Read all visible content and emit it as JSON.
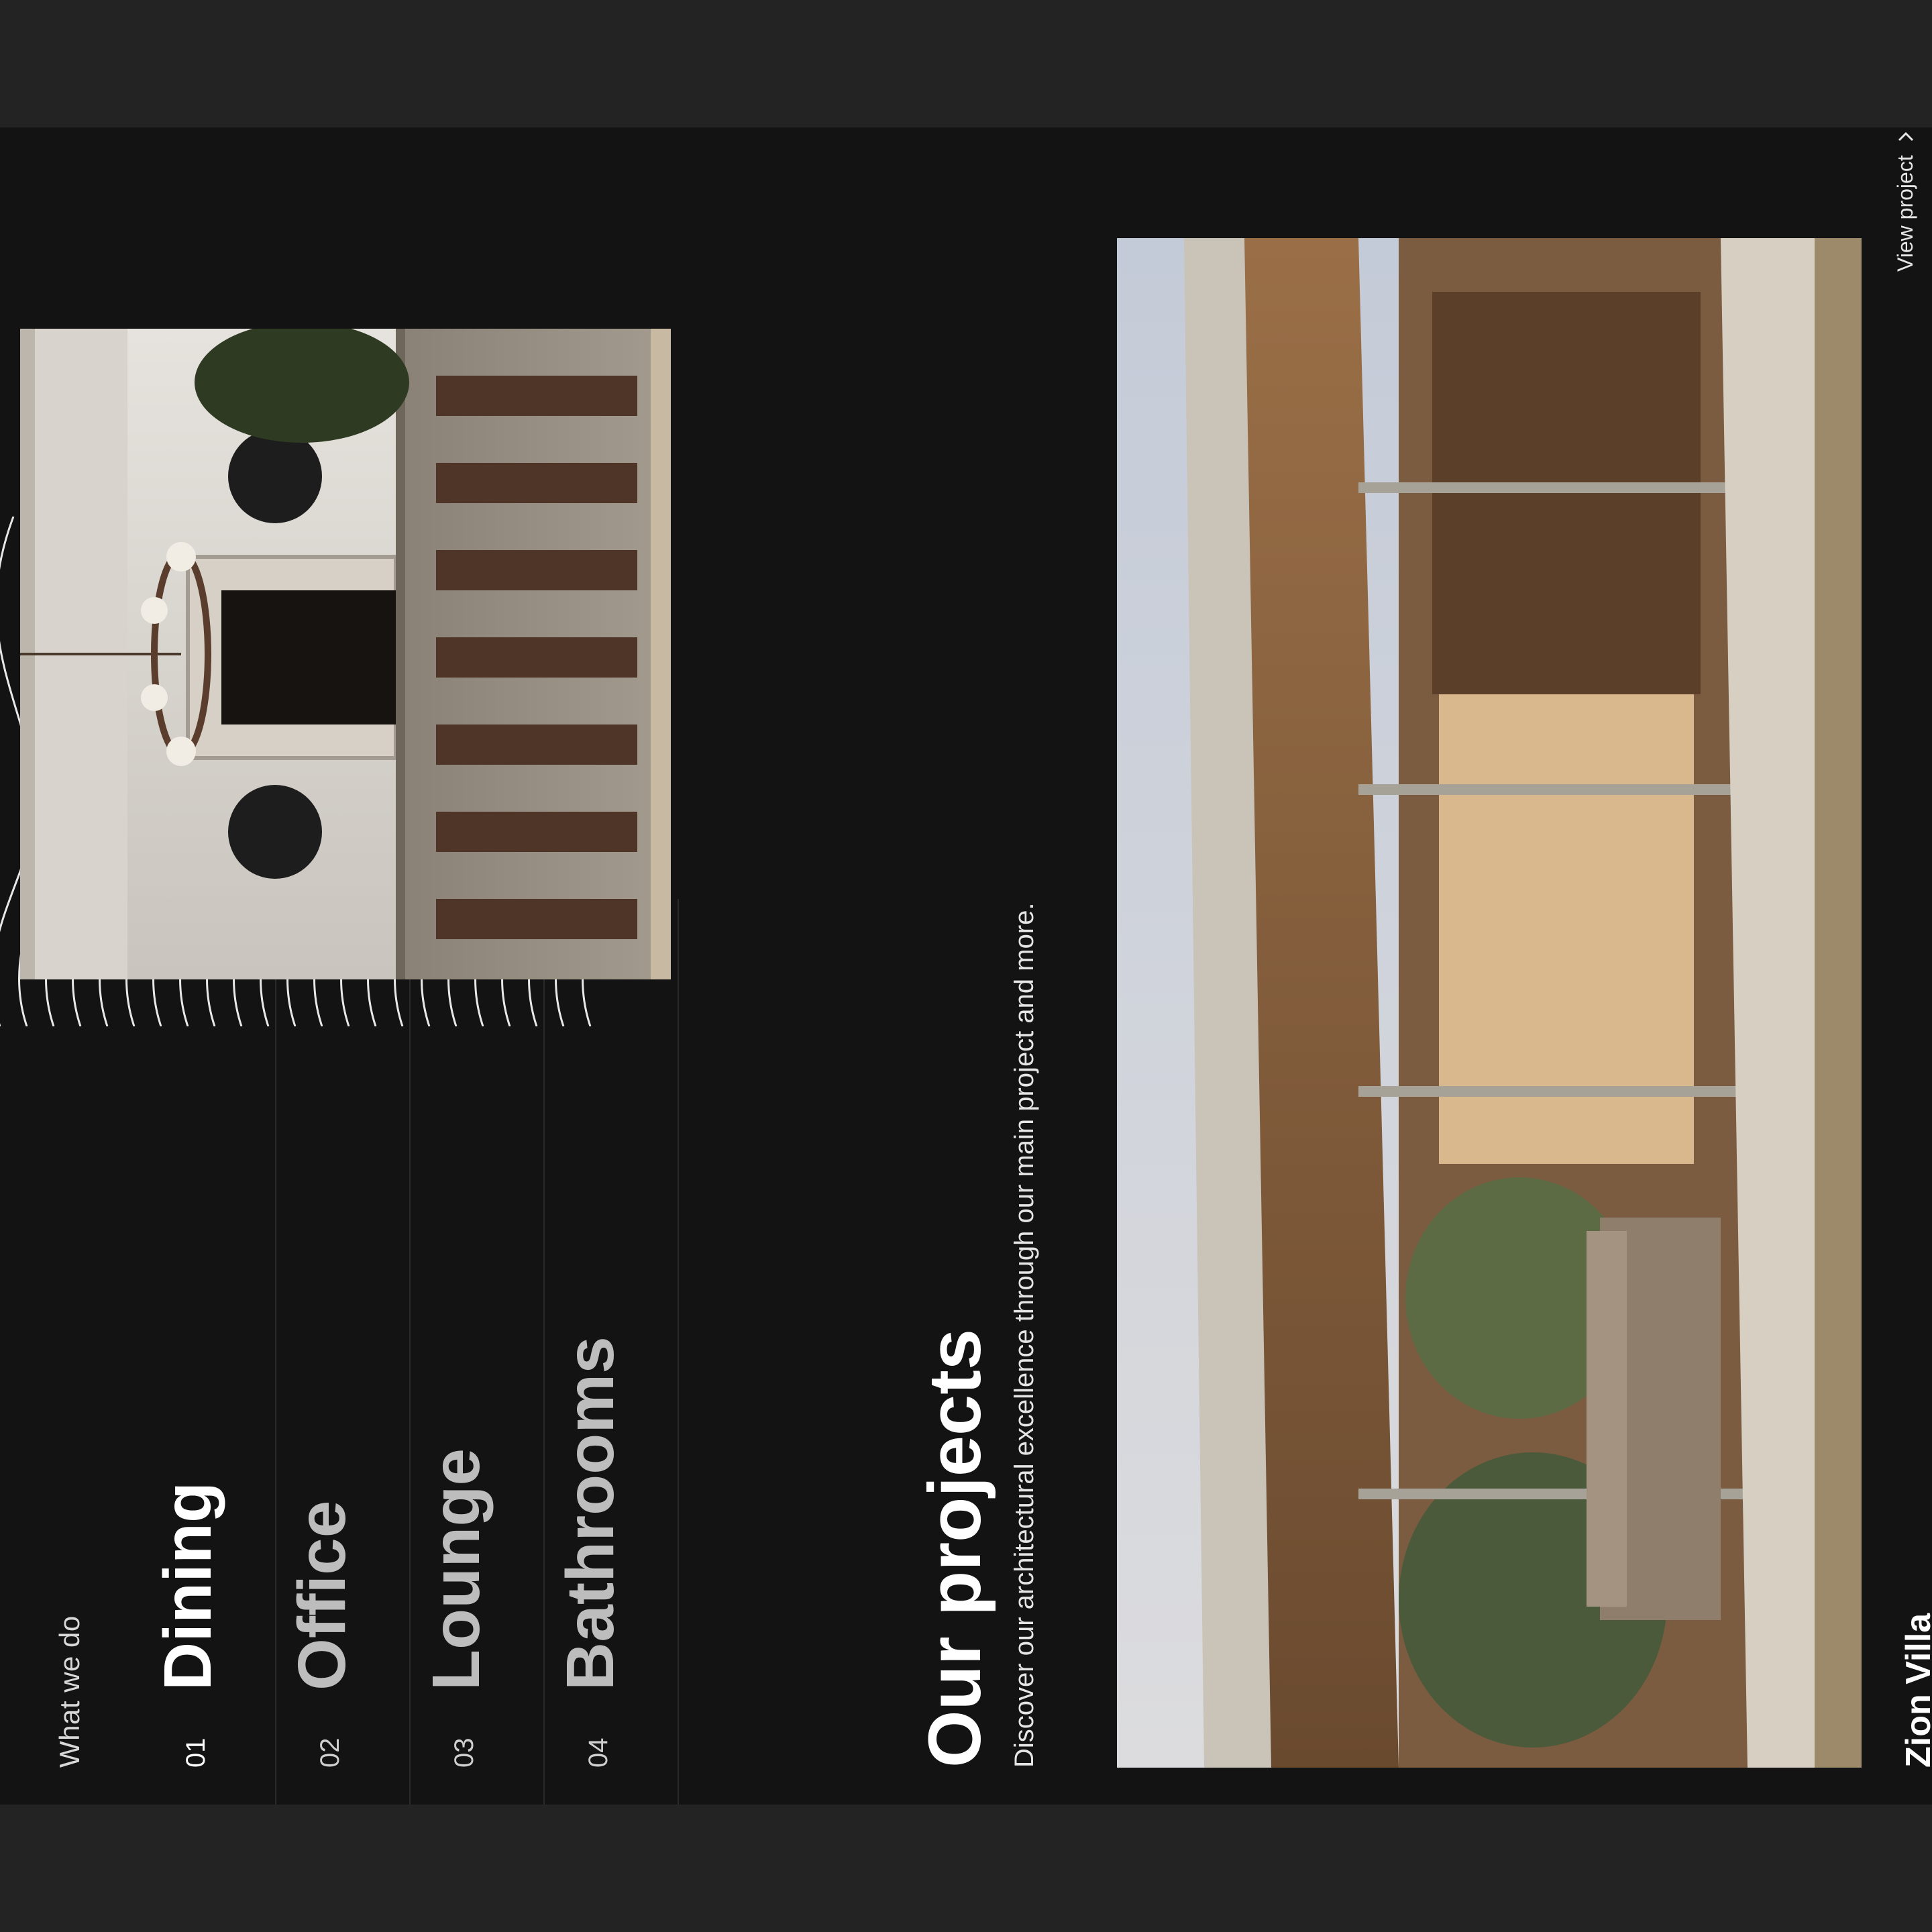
{
  "services": {
    "eyebrow": "What we do",
    "items": [
      {
        "num": "01",
        "label": "Dining"
      },
      {
        "num": "02",
        "label": "Office"
      },
      {
        "num": "03",
        "label": "Lounge"
      },
      {
        "num": "04",
        "label": "Bathrooms"
      }
    ]
  },
  "projects": {
    "title": "Our projects",
    "subtitle": "Discover our architectural excellence through our main project and more.",
    "featured_name": "Zion Villa",
    "view_label": "View project",
    "view_icon": "chevron-right-icon"
  },
  "colors": {
    "background": "#131313",
    "frame": "#232323",
    "text": "#ffffff"
  }
}
